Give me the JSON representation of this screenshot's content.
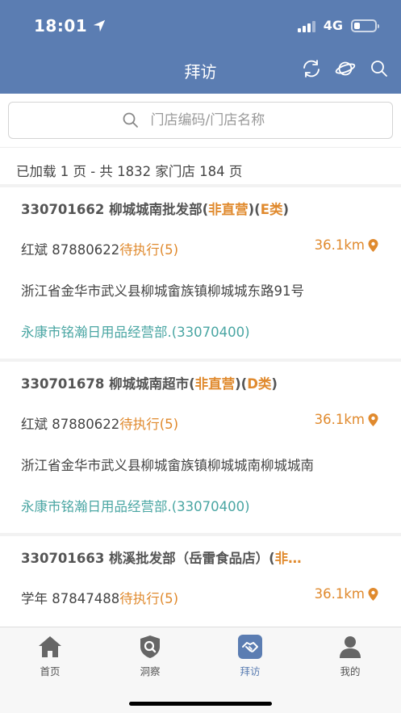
{
  "status_bar": {
    "time": "18:01",
    "network": "4G"
  },
  "nav": {
    "title": "拜访",
    "icons": [
      "refresh-icon",
      "planet-icon",
      "search-icon"
    ]
  },
  "search": {
    "placeholder": "门店编码/门店名称"
  },
  "summary": "已加载 1 页 - 共 1832 家门店 184 页",
  "stores": [
    {
      "code_name": "330701662 柳城城南批发部",
      "type_label": "非直营",
      "class_label": "E类",
      "contact": "红斌 87880622",
      "pending": "待执行(5)",
      "distance": "36.1km",
      "address": "浙江省金华市武义县柳城畲族镇柳城城东路91号",
      "dealer": "永康市铭瀚日用品经营部.(33070400)"
    },
    {
      "code_name": "330701678 柳城城南超市",
      "type_label": "非直营",
      "class_label": "D类",
      "contact": "红斌 87880622",
      "pending": "待执行(5)",
      "distance": "36.1km",
      "address": "浙江省金华市武义县柳城畲族镇柳城城南柳城城南",
      "dealer": "永康市铭瀚日用品经营部.(33070400)"
    },
    {
      "code_name": "330701663 桃溪批发部（岳雷食品店）",
      "type_label": "非…",
      "contact": "学年 87847488",
      "pending": "待执行(5)",
      "distance": "36.1km"
    }
  ],
  "tabs": [
    {
      "label": "首页",
      "icon": "home-icon"
    },
    {
      "label": "洞察",
      "icon": "insight-icon"
    },
    {
      "label": "拜访",
      "icon": "handshake-icon",
      "active": true
    },
    {
      "label": "我的",
      "icon": "user-icon"
    }
  ],
  "colors": {
    "primary": "#5b7db2",
    "accent": "#e08a2e",
    "dealer": "#4aa6a3"
  }
}
